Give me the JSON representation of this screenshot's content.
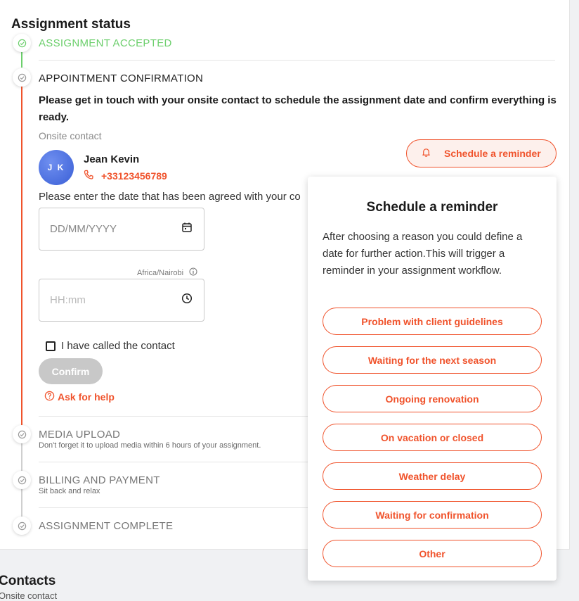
{
  "page": {
    "title": "Assignment status",
    "steps": [
      {
        "title": "ASSIGNMENT ACCEPTED",
        "subtitle": ""
      },
      {
        "title": "APPOINTMENT CONFIRMATION",
        "subtitle": ""
      },
      {
        "title": "MEDIA UPLOAD",
        "subtitle": "Don't forget it to upload media within 6 hours of your assignment."
      },
      {
        "title": "BILLING AND PAYMENT",
        "subtitle": "Sit back and relax"
      },
      {
        "title": "ASSIGNMENT COMPLETE",
        "subtitle": ""
      }
    ]
  },
  "appointment": {
    "message": "Please get in touch with your onsite contact to schedule the assignment date and confirm everything is ready.",
    "onsite_label": "Onsite contact",
    "contact": {
      "initials": "J K",
      "name": "Jean Kevin",
      "phone": "+33123456789"
    },
    "date_prompt": "Please enter the date that has been agreed with your co",
    "date_placeholder": "DD/MM/YYYY",
    "timezone": "Africa/Nairobi",
    "time_placeholder": "HH:mm",
    "called_label": "I have called the contact",
    "confirm_label": "Confirm",
    "help_label": "Ask for help",
    "reminder_button": "Schedule a reminder"
  },
  "reminder_popup": {
    "title": "Schedule a reminder",
    "description": "After choosing a reason you could define a date for further action.This will trigger a reminder in your assignment workflow.",
    "reasons": [
      "Problem with client guidelines",
      "Waiting for the next season",
      "Ongoing renovation",
      "On vacation or closed",
      "Weather delay",
      "Waiting for confirmation",
      "Other"
    ]
  },
  "contacts": {
    "title": "Contacts",
    "subtitle": "Onsite contact"
  },
  "colors": {
    "accent": "#f0532c",
    "success": "#6ccf6c",
    "rail_active": "#f0532c",
    "rail_inactive": "#cfcfcf"
  },
  "icons": [
    "check-icon",
    "calendar-icon",
    "clock-icon",
    "info-icon",
    "phone-icon",
    "bell-icon",
    "question-circle-icon"
  ]
}
